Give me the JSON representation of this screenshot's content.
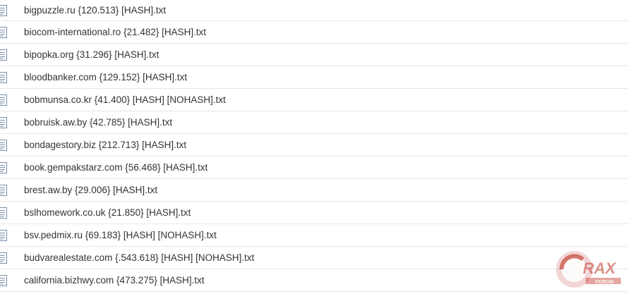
{
  "file_list": {
    "items": [
      {
        "name": "bigpuzzle.ru {120.513} [HASH].txt",
        "icon": "text-file-icon"
      },
      {
        "name": "biocom-international.ro {21.482} [HASH].txt",
        "icon": "text-file-icon"
      },
      {
        "name": "bipopka.org {31.296} [HASH].txt",
        "icon": "text-file-icon"
      },
      {
        "name": "bloodbanker.com {129.152} [HASH].txt",
        "icon": "text-file-icon"
      },
      {
        "name": "bobmunsa.co.kr {41.400} [HASH] [NOHASH].txt",
        "icon": "text-file-icon"
      },
      {
        "name": "bobruisk.aw.by {42.785} [HASH].txt",
        "icon": "text-file-icon"
      },
      {
        "name": "bondagestory.biz {212.713} [HASH].txt",
        "icon": "text-file-icon"
      },
      {
        "name": "book.gempakstarz.com {56.468} [HASH].txt",
        "icon": "text-file-icon"
      },
      {
        "name": "brest.aw.by {29.006} [HASH].txt",
        "icon": "text-file-icon"
      },
      {
        "name": "bslhomework.co.uk {21.850} [HASH].txt",
        "icon": "text-file-icon"
      },
      {
        "name": "bsv.pedmix.ru {69.183} [HASH] [NOHASH].txt",
        "icon": "text-file-icon"
      },
      {
        "name": "budvarealestate.com {.543.618} [HASH] [NOHASH].txt",
        "icon": "text-file-icon"
      },
      {
        "name": "california.bizhwy.com {473.275} [HASH].txt",
        "icon": "text-file-icon"
      }
    ]
  },
  "watermark": {
    "text": "RAX",
    "subtext": "FORUM",
    "colors": {
      "primary": "#c0392b",
      "light": "#e8b4b4"
    }
  },
  "colors": {
    "text": "#333333",
    "row_border": "#e6e6e6",
    "icon_stroke": "#7a8fa6"
  }
}
